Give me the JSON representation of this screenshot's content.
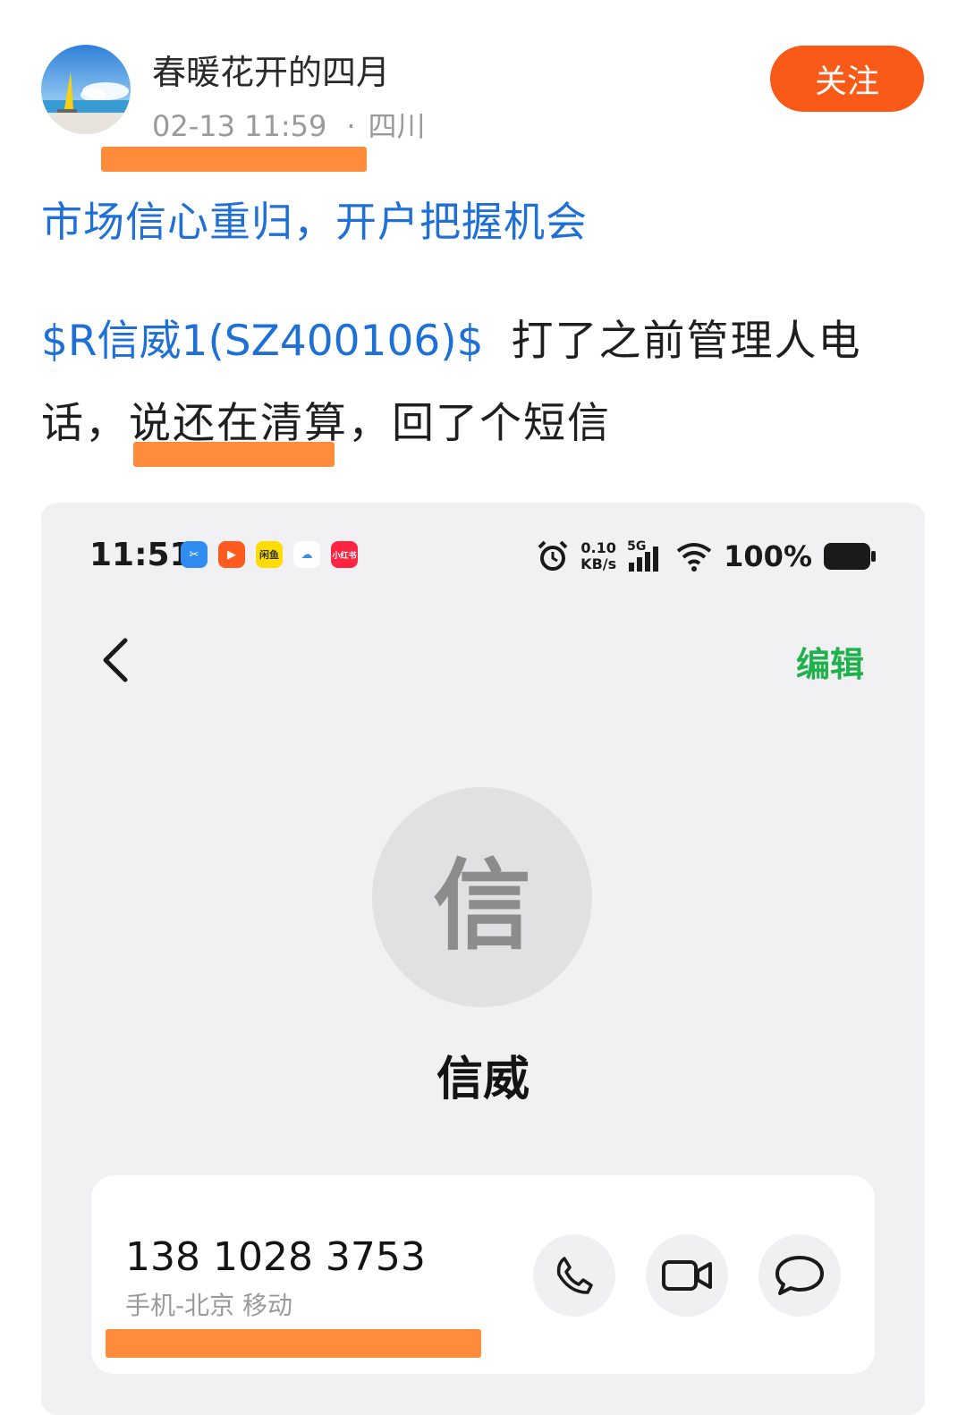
{
  "post": {
    "username": "春暖花开的四月",
    "timestamp": "02-13 11:59",
    "dot": "·",
    "location": "四川",
    "follow_label": "关注",
    "headline": "市场信心重归，开户把握机会",
    "stock_tag": "$R信威1(SZ400106)$",
    "body_line1_rest": "打了之前管理人电",
    "body_line2_a": "话，",
    "body_line2_highlight": "说还在清算",
    "body_line2_b": "，回了个短信",
    "highlight_color": "#ff8c3a"
  },
  "screenshot": {
    "status_bar": {
      "time": "11:51",
      "app_icons": [
        {
          "name": "scissor-app-icon",
          "label": "",
          "color": "#2f8cf0"
        },
        {
          "name": "video-app-icon",
          "label": "",
          "color": "#ff5a1f"
        },
        {
          "name": "xianyu-app-icon",
          "label": "闲鱼",
          "color": "#ffdd00"
        },
        {
          "name": "cloud-app-icon",
          "label": "",
          "color": "#ffffff"
        },
        {
          "name": "xiaohongshu-app-icon",
          "label": "小红书",
          "color": "#ff2442"
        }
      ],
      "net_speed_value": "0.10",
      "net_speed_unit": "KB/s",
      "network": "5G",
      "battery": "100%"
    },
    "edit_label": "编辑",
    "contact_initial": "信",
    "contact_name": "信威",
    "phone_number": "138 1028 3753",
    "phone_type": "手机-北京 移动",
    "accent_color": "#1fb14c"
  }
}
